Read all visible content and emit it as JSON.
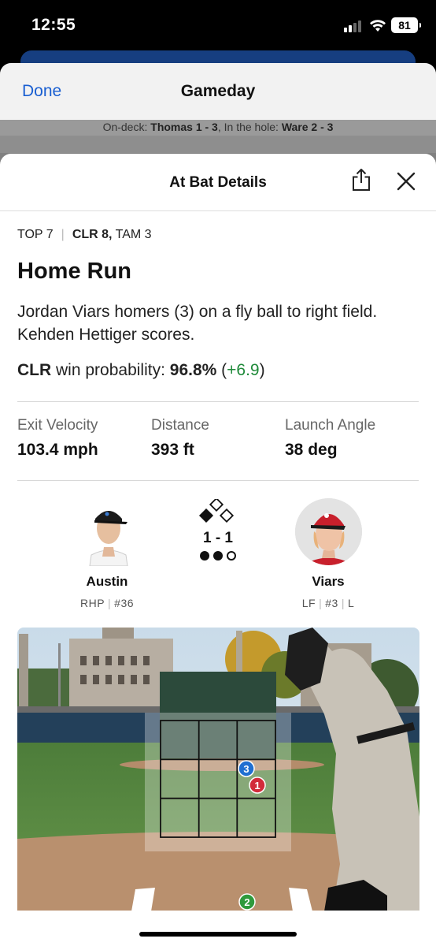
{
  "status_bar": {
    "time": "12:55",
    "battery": "81"
  },
  "gameday": {
    "done_label": "Done",
    "title": "Gameday",
    "on_deck_label": "On-deck:",
    "on_deck_value": "Thomas 1 - 3",
    "in_hole_label": "In the hole:",
    "in_hole_value": "Ware 2 - 3"
  },
  "at_bat": {
    "title": "At Bat Details",
    "inning": "TOP 7",
    "score_leader": "CLR 8,",
    "score_trailer": "TAM 3",
    "result": "Home Run",
    "description": "Jordan Viars homers (3) on a fly ball to right field. Kehden Hettiger scores.",
    "wp_team": "CLR",
    "wp_label": "win probability:",
    "wp_value": "96.8%",
    "wp_open": "(",
    "wp_change": "+6.9",
    "wp_close": ")",
    "stats": [
      {
        "label": "Exit Velocity",
        "value": "103.4 mph"
      },
      {
        "label": "Distance",
        "value": "393 ft"
      },
      {
        "label": "Launch Angle",
        "value": "38 deg"
      }
    ]
  },
  "matchup": {
    "pitcher": {
      "name": "Austin",
      "hand": "RHP",
      "number": "#36"
    },
    "count": "1 - 1",
    "batter": {
      "name": "Viars",
      "position": "LF",
      "number": "#3",
      "bats": "L"
    }
  },
  "pitches": [
    {
      "label": "3",
      "color": "#1f6fd1"
    },
    {
      "label": "1",
      "color": "#d22b3a"
    },
    {
      "label": "2",
      "color": "#2e9a3c"
    }
  ],
  "colors": {
    "accent": "#1a5fd1",
    "positive": "#1f8a3a"
  }
}
